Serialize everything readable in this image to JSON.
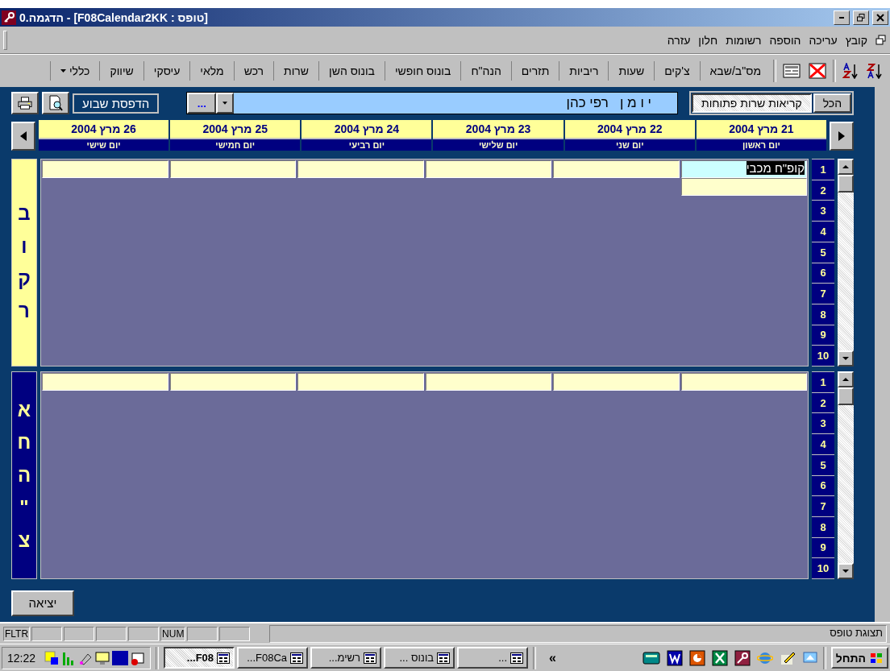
{
  "window": {
    "title": "0.הדגמה - [F08Calendar2KK : טופס]"
  },
  "menu": [
    "קובץ",
    "עריכה",
    "הוספה",
    "רשומות",
    "חלון",
    "עזרה"
  ],
  "toolbar": [
    {
      "kind": "button",
      "label": "מס\"ב/שבא"
    },
    {
      "kind": "button",
      "label": "צ'קים"
    },
    {
      "kind": "button",
      "label": "שעות"
    },
    {
      "kind": "button",
      "label": "ריביות"
    },
    {
      "kind": "button",
      "label": "תזרים"
    },
    {
      "kind": "button",
      "label": "הנה\"ח"
    },
    {
      "kind": "button",
      "label": "בונוס חופשי"
    },
    {
      "kind": "button",
      "label": "בונוס השן"
    },
    {
      "kind": "button",
      "label": "שרות"
    },
    {
      "kind": "button",
      "label": "רכש"
    },
    {
      "kind": "button",
      "label": "מלאי"
    },
    {
      "kind": "button",
      "label": "עיסקי"
    },
    {
      "kind": "button",
      "label": "שיווק"
    },
    {
      "kind": "dropdown",
      "label": "כללי"
    }
  ],
  "filters": [
    {
      "label": "הכל",
      "selected": false
    },
    {
      "label": "קריאות שרות פתוחות",
      "selected": true
    }
  ],
  "diary_field": {
    "value": "י ו מ ן   רפי כהן",
    "button": "..."
  },
  "print_week": "הדפסת שבוע",
  "days": [
    {
      "date": "21 מרץ 2004",
      "day": "יום ראשון"
    },
    {
      "date": "22 מרץ 2004",
      "day": "יום שני"
    },
    {
      "date": "23 מרץ 2004",
      "day": "יום שלישי"
    },
    {
      "date": "24 מרץ 2004",
      "day": "יום רביעי"
    },
    {
      "date": "25 מרץ 2004",
      "day": "יום חמישי"
    },
    {
      "date": "26 מרץ 2004",
      "day": "יום שישי"
    }
  ],
  "sections": [
    {
      "label": "בוקר",
      "kind": "light",
      "rows": [
        "1",
        "2",
        "3",
        "4",
        "5",
        "6",
        "7",
        "8",
        "9",
        "10"
      ],
      "days": [
        {
          "slots": [
            {
              "text": "קופ\"ח מכבי",
              "selected": true
            },
            {
              "selected": false
            }
          ]
        },
        {
          "slots": [
            {
              "selected": false
            }
          ]
        },
        {
          "slots": [
            {
              "selected": false
            }
          ]
        },
        {
          "slots": [
            {
              "selected": false
            }
          ]
        },
        {
          "slots": [
            {
              "selected": false
            }
          ]
        },
        {
          "slots": [
            {
              "selected": false
            }
          ]
        }
      ]
    },
    {
      "label": "אחה\"צ",
      "kind": "dark",
      "rows": [
        "1",
        "2",
        "3",
        "4",
        "5",
        "6",
        "7",
        "8",
        "9",
        "10"
      ],
      "days": [
        {
          "slots": [
            {
              "selected": false
            }
          ]
        },
        {
          "slots": [
            {
              "selected": false
            }
          ]
        },
        {
          "slots": [
            {
              "selected": false
            }
          ]
        },
        {
          "slots": [
            {
              "selected": false
            }
          ]
        },
        {
          "slots": [
            {
              "selected": false
            }
          ]
        },
        {
          "slots": [
            {
              "selected": false
            }
          ]
        }
      ]
    }
  ],
  "exit_button": "יציאה",
  "status_bar": {
    "panels": [
      {
        "kind": "empty"
      },
      {
        "kind": "empty"
      },
      {
        "kind": "text",
        "text": "NUM"
      },
      {
        "kind": "empty"
      },
      {
        "kind": "empty"
      },
      {
        "kind": "empty"
      },
      {
        "kind": "empty"
      },
      {
        "kind": "text",
        "text": "FLTR"
      }
    ],
    "message": "תצוגת טופס"
  },
  "taskbar": {
    "start": "התחל",
    "tasks": [
      {
        "label": "...",
        "selected": false
      },
      {
        "label": "בונוס ...",
        "selected": false
      },
      {
        "label": "רשימ...",
        "selected": false
      },
      {
        "label": "F08Ca...",
        "selected": false
      },
      {
        "label": "F08...",
        "selected": true
      }
    ],
    "more": "«",
    "clock": "12:22"
  }
}
